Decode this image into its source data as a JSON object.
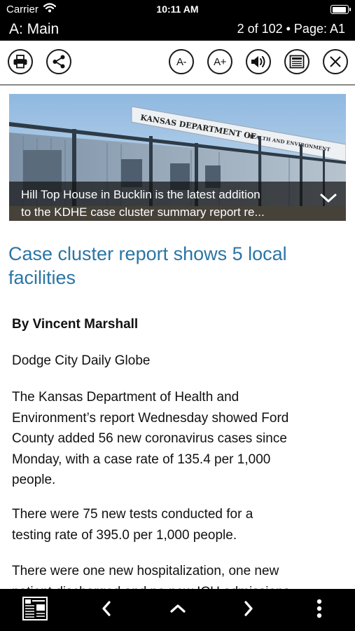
{
  "status_bar": {
    "carrier": "Carrier",
    "time": "10:11 AM",
    "battery_level": 0.95
  },
  "nav": {
    "section": "A: Main",
    "page_info": "2 of 102 • Page: A1"
  },
  "toolbar": {
    "font_decrease_label": "A-",
    "font_increase_label": "A+",
    "icons": [
      "print-icon",
      "share-icon",
      "font-decrease-icon",
      "font-increase-icon",
      "speaker-icon",
      "newspaper-icon",
      "close-icon"
    ]
  },
  "hero": {
    "sign_text_1": "KANSAS DEPARTMENT OF",
    "sign_text_2": "HEALTH AND ENVIRONMENT",
    "caption_line1": "Hill Top House in Bucklin is the latest addition",
    "caption_line2": "to the KDHE case cluster summary report re..."
  },
  "article": {
    "title_line1": "Case cluster report shows 5 local",
    "title_line2": "facilities",
    "author": "By Vincent Marshall",
    "publication": "Dodge City Daily Globe",
    "paragraphs": [
      [
        "The Kansas Department of Health and",
        "Environment’s report Wednesday showed Ford",
        "County added 56 new coronavirus cases since",
        "Monday, with a case rate of 135.4 per 1,000",
        "people."
      ],
      [
        "There were 75 new tests conducted for a",
        "testing rate of 395.0 per 1,000 people."
      ],
      [
        "There were one new hospitalization, one new",
        "patient discharged and no new ICU admissions"
      ]
    ]
  },
  "bottom_bar": {
    "icons": [
      "pages-thumbnail-icon",
      "previous-icon",
      "up-icon",
      "next-icon",
      "more-icon"
    ]
  }
}
